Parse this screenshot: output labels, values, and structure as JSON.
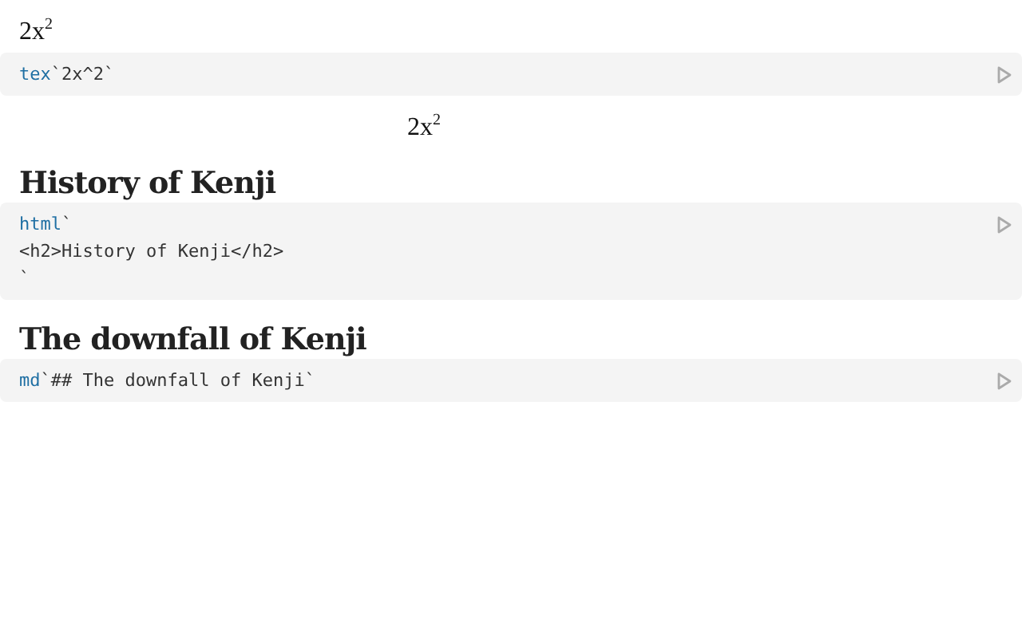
{
  "cells": [
    {
      "output": {
        "kind": "inline-math",
        "text": "2x$^{2}$"
      },
      "code": {
        "tag": "tex",
        "body": "`2x^2`"
      }
    },
    {
      "output": {
        "kind": "display-math",
        "text": "2x$^{2}$"
      }
    },
    {
      "output": {
        "kind": "heading",
        "text": "History of Kenji"
      },
      "code": {
        "tag": "html",
        "body": "`\n<h2>History of Kenji</h2>\n`"
      }
    },
    {
      "output": {
        "kind": "heading",
        "text": "The downfall of Kenji"
      },
      "code": {
        "tag": "md",
        "body": "`## The downfall of Kenji`"
      }
    }
  ]
}
